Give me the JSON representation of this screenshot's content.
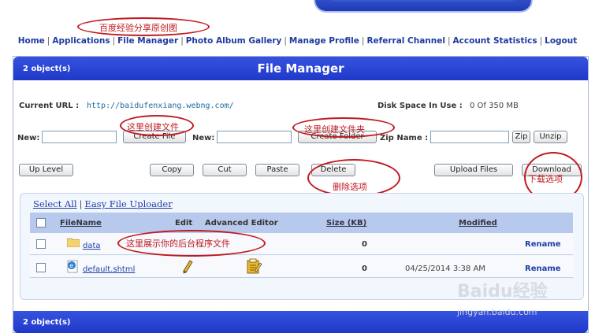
{
  "annotations": {
    "top_note": "百度经验分享原创图",
    "create_file": "这里创建文件",
    "create_folder": "这里创建文件夹",
    "delete_option": "删除选项",
    "download_option": "下载选项",
    "file_list_note": "这里展示你的后台程序文件"
  },
  "nav": [
    "Home",
    "Applications",
    "File Manager",
    "Photo Album Gallery",
    "Manage Profile",
    "Referral Channel",
    "Account Statistics",
    "Logout"
  ],
  "panel": {
    "title": "File Manager",
    "object_count": "2 object(s)",
    "footer_count": "2 object(s)"
  },
  "info": {
    "url_label": "Current URL :",
    "url_value": "http://baidufenxiang.webng.com/",
    "disk_label": "Disk Space In Use :",
    "disk_value": "0 Of 350 MB"
  },
  "create": {
    "new_label_1": "New:",
    "create_file_btn": "Create File",
    "new_label_2": "New:",
    "create_folder_btn": "Create Folder",
    "zip_label": "Zip Name :",
    "zip_btn": "Zip",
    "unzip_btn": "Unzip"
  },
  "actions": {
    "up_level": "Up Level",
    "copy": "Copy",
    "cut": "Cut",
    "paste": "Paste",
    "delete": "Delete",
    "upload": "Upload Files",
    "download": "Download"
  },
  "list": {
    "select_all": "Select All",
    "easy_uploader": "Easy File Uploader",
    "columns": {
      "filename": "FileName",
      "edit": "Edit",
      "advanced": "Advanced Editor",
      "size": "Size (KB)",
      "modified": "Modified"
    },
    "rows": [
      {
        "name": "data",
        "icon": "folder-icon",
        "size": "0",
        "modified": "",
        "action": "Rename"
      },
      {
        "name": "default.shtml",
        "icon": "html-file-icon",
        "size": "0",
        "modified": "04/25/2014 3:38 AM",
        "action": "Rename"
      }
    ]
  },
  "watermark": {
    "brand": "Baidu经验",
    "site": "jingyan.baidu.com"
  },
  "colors": {
    "header_blue": "#2540d0",
    "annotation_red": "#c1191f",
    "link_blue": "#1d3fa8",
    "table_header": "#b7c9ec"
  }
}
